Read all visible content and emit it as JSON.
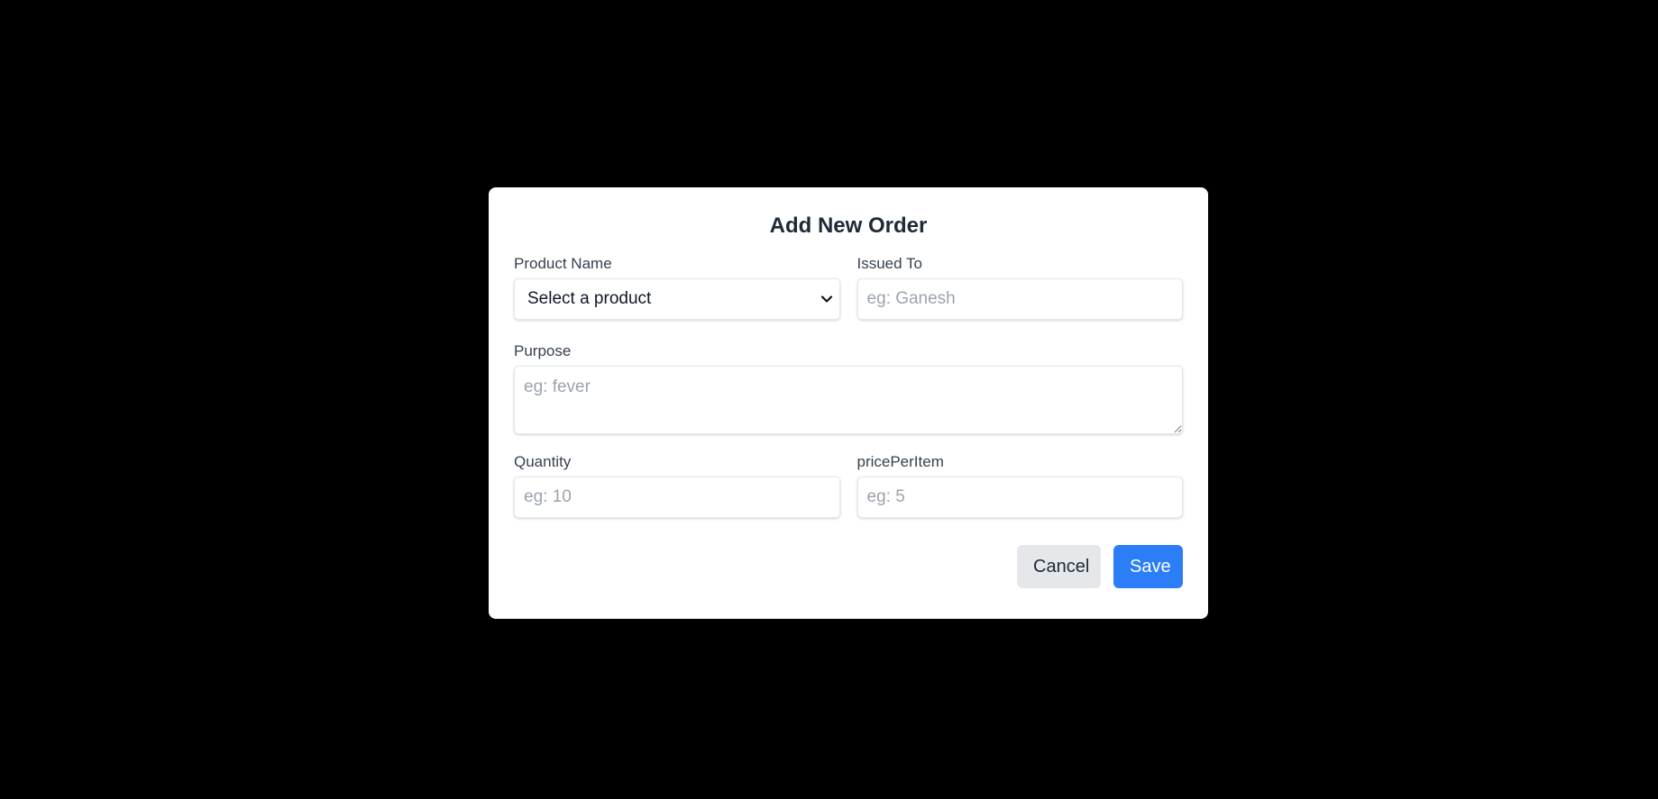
{
  "modal": {
    "title": "Add New Order"
  },
  "form": {
    "product_name": {
      "label": "Product Name",
      "selected": "Select a product"
    },
    "issued_to": {
      "label": "Issued To",
      "placeholder": "eg: Ganesh",
      "value": ""
    },
    "purpose": {
      "label": "Purpose",
      "placeholder": "eg: fever",
      "value": ""
    },
    "quantity": {
      "label": "Quantity",
      "placeholder": "eg: 10",
      "value": ""
    },
    "price_per_item": {
      "label": "pricePerItem",
      "placeholder": "eg: 5",
      "value": ""
    }
  },
  "actions": {
    "cancel_label": "Cancel",
    "save_label": "Save"
  },
  "colors": {
    "backdrop": "#000000",
    "primary": "#2b7ef7",
    "secondary_button": "#e5e7eb",
    "title_text": "#1f2937"
  },
  "icons": {
    "select_chevron": "chevron-down-icon"
  }
}
